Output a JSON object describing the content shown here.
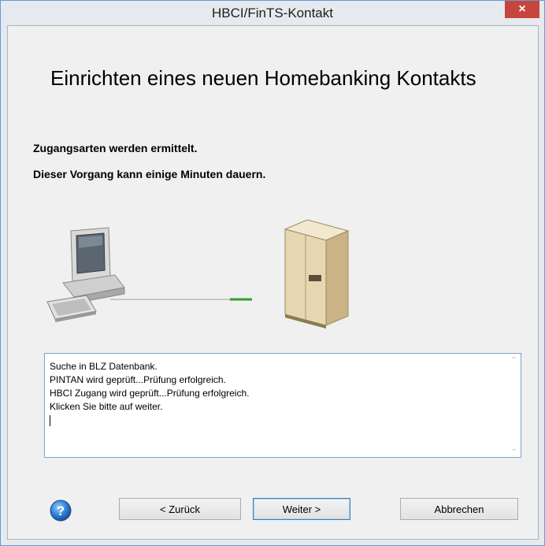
{
  "window": {
    "title": "HBCI/FinTS-Kontakt",
    "close_glyph": "×"
  },
  "heading": "Einrichten eines neuen Homebanking Kontakts",
  "status": {
    "line1": "Zugangsarten werden ermittelt.",
    "line2": "Dieser Vorgang kann einige Minuten dauern."
  },
  "log": {
    "lines": [
      "Suche in BLZ Datenbank.",
      "PINTAN wird geprüft...Prüfung erfolgreich.",
      "HBCI Zugang wird geprüft...Prüfung erfolgreich.",
      "Klicken Sie bitte auf weiter."
    ],
    "scroll_up": "⌃",
    "scroll_down": "⌄"
  },
  "buttons": {
    "back": "< Zurück",
    "next": "Weiter >",
    "cancel": "Abbrechen",
    "help_glyph": "?"
  },
  "icons": {
    "computer": "computer-icon",
    "server": "server-icon",
    "help": "help-icon"
  },
  "colors": {
    "accent": "#5b9fd8",
    "close": "#c7453c",
    "connection": "#2e9e2e"
  }
}
